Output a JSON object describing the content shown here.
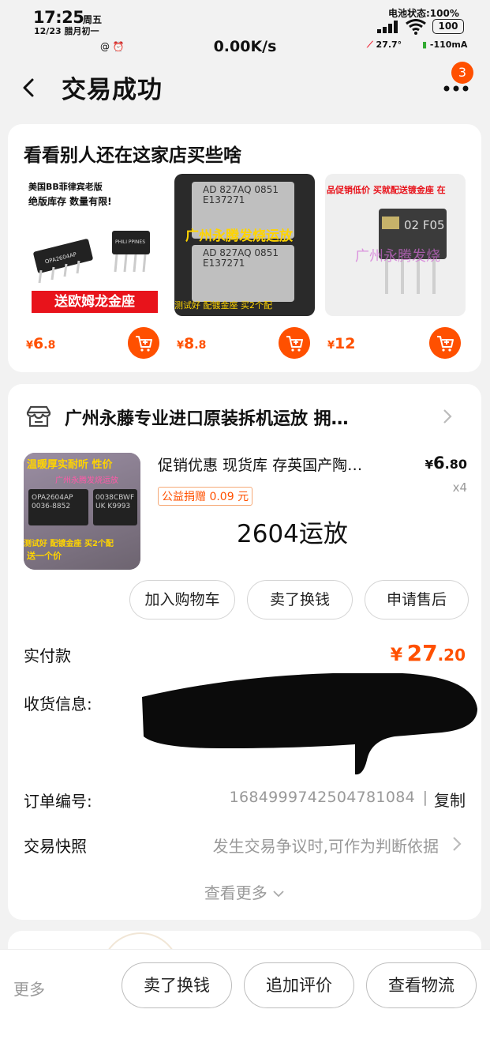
{
  "status_bar": {
    "time": "17:25",
    "weekday": "周五",
    "date": "12/23 腊月初一",
    "small_icons": "@ ⏰",
    "net_speed": "0.00K/s",
    "battery_status": "电池状态:100%",
    "battery_level": "100",
    "temperature": "27.7°",
    "current": "-110mA"
  },
  "nav": {
    "title": "交易成功",
    "badge_count": "3"
  },
  "recommend": {
    "title": "看看别人还在这家店买些啥",
    "items": [
      {
        "banner_top": "美国BB菲律宾老版",
        "banner_mid": "绝版库存 数量有限!",
        "banner_bottom": "送欧姆龙金座",
        "chip_left": "OPA2604AP",
        "chip_right": "PHILI PPINES",
        "price_currency": "¥",
        "price_int": "6",
        "price_dec": ".8"
      },
      {
        "chip_text1": "AD 827AQ 0851 E137271",
        "chip_text2": "AD 827AQ 0851 E137271",
        "overlay": "广州永腾发烧运放",
        "overlay_bottom": "测试好 配镀金座 买2个配",
        "price_currency": "¥",
        "price_int": "8",
        "price_dec": ".8"
      },
      {
        "banner_top": "品促销低价 买就配送镀金座 在",
        "chip_text": "02 F05",
        "watermark": "广州永腾发烧",
        "price_currency": "¥",
        "price_int": "12",
        "price_dec": ""
      }
    ]
  },
  "order": {
    "shop_name": "广州永藤专业进口原装拆机运放 拥…",
    "product": {
      "title": "促销优惠 现货库 存英国产陶…",
      "price_currency": "¥",
      "price_int": "6",
      "price_dec": ".80",
      "qty": "x4",
      "charity_tag": "公益捐赠 0.09 元",
      "spec": "2604运放",
      "img_top": "温暖厚实耐听 性价",
      "img_mid": "广州永腾发烧运放",
      "img_chip_left": "OPA2604AP 0036-8852",
      "img_chip_right": "0038CBWF UK K9993",
      "img_bottom": "测试好 配镀金座 买2个配",
      "img_bottom2": "送一个价"
    },
    "actions": [
      "加入购物车",
      "卖了换钱",
      "申请售后"
    ],
    "paid_label": "实付款",
    "paid_currency": "¥",
    "paid_int": "27",
    "paid_dec": ".20",
    "shipping_label": "收货信息:",
    "order_no_label": "订单编号:",
    "order_no": "1684999742504781084",
    "separator": "|",
    "copy": "复制",
    "snapshot_label": "交易快照",
    "snapshot_hint": "发生交易争议时,可作为判断依据",
    "see_more": "查看更多"
  },
  "bottom_bar": {
    "more": "更多",
    "buttons": [
      "卖了换钱",
      "追加评价",
      "查看物流"
    ]
  },
  "colors": {
    "accent": "#ff5000",
    "muted": "#999999",
    "background": "#f2f2f2"
  }
}
